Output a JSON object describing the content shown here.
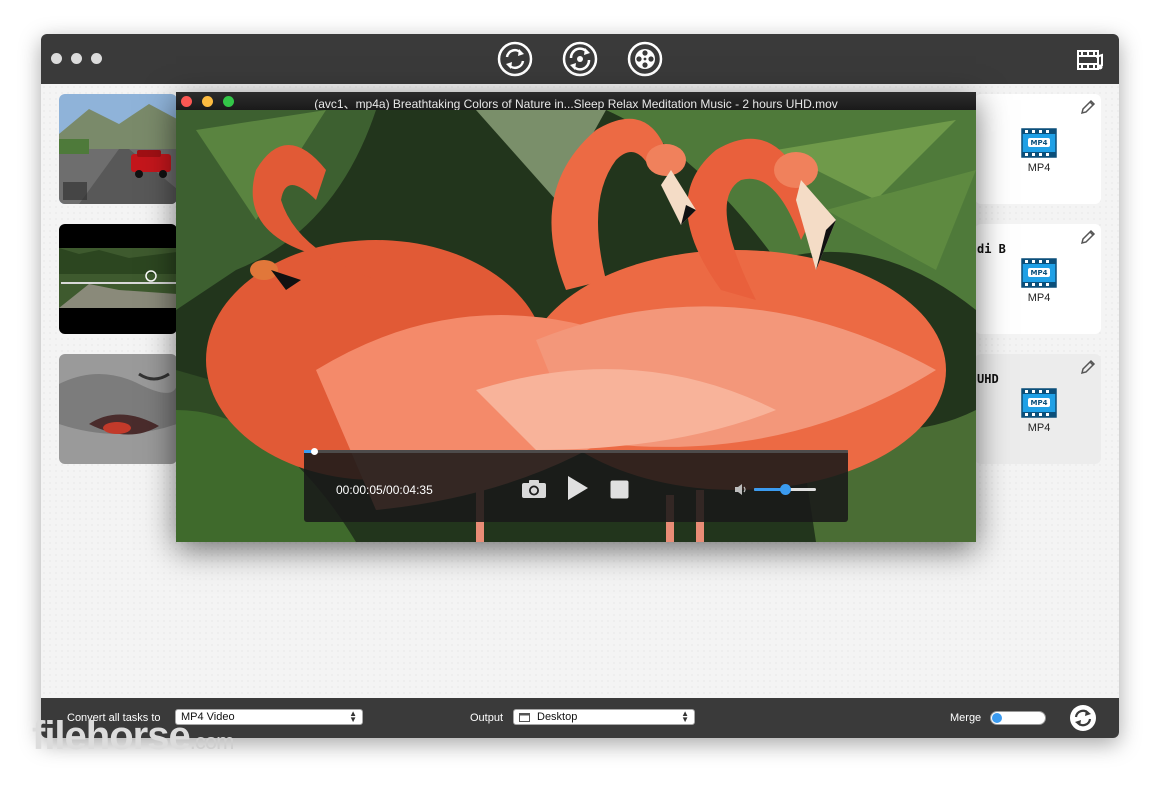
{
  "toolbar": {
    "window_controls": [
      "close-dot",
      "minimize-dot",
      "zoom-dot"
    ],
    "buttons": [
      {
        "name": "convert-tab-icon",
        "active": true
      },
      {
        "name": "rotate-tab-icon",
        "active": false
      },
      {
        "name": "film-reel-tab-icon",
        "active": false
      }
    ],
    "right_icon": "film-music-icon"
  },
  "tasks": [
    {
      "title": "",
      "format": "MP4",
      "selected": false
    },
    {
      "title": "di B",
      "format": "MP4",
      "selected": false
    },
    {
      "title": "UHD",
      "format": "MP4",
      "selected": true
    }
  ],
  "player": {
    "title": "(avc1、mp4a)  Breathtaking Colors of Nature in...Sleep Relax Meditation Music - 2 hours UHD.mov",
    "timecode": "00:00:05/00:04:35",
    "progress": 0.019,
    "volume": 0.5,
    "controls": [
      "camera-icon",
      "play-icon",
      "stop-icon",
      "speaker-icon"
    ]
  },
  "bottombar": {
    "convert_label": "Convert all tasks to",
    "convert_value": "MP4 Video",
    "output_label": "Output",
    "output_value": "Desktop",
    "merge_label": "Merge",
    "merge_on": false
  },
  "watermark": {
    "main": "filehorse",
    "suffix": ".com"
  },
  "colors": {
    "accent": "#3b9bf0",
    "titlebar": "#3a3a3a",
    "mp4_icon": "#1fa0e6"
  }
}
